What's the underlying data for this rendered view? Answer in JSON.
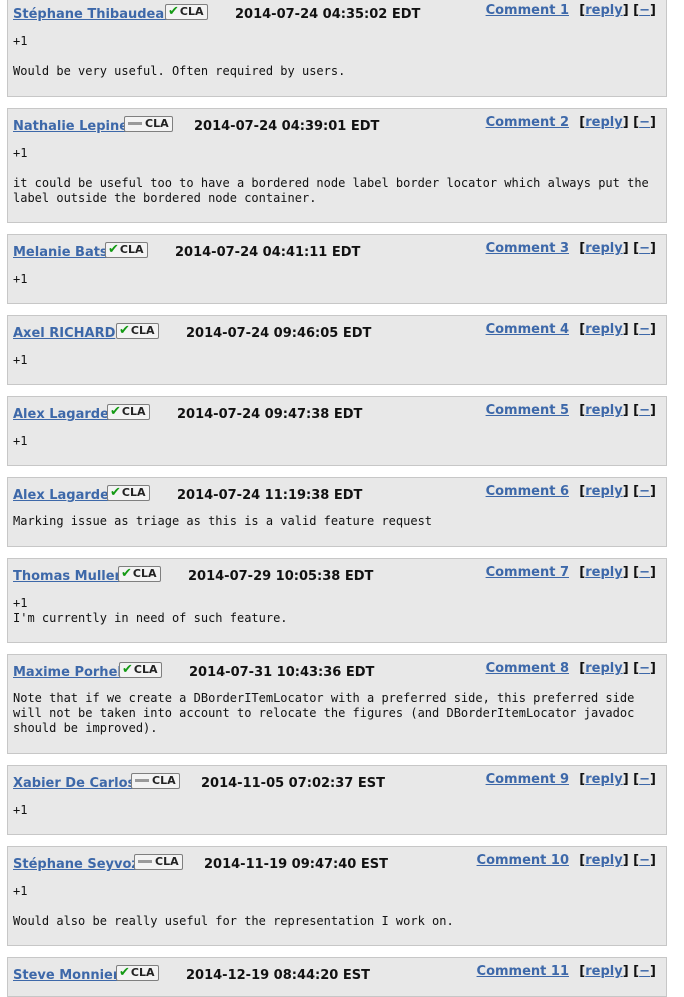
{
  "comments": [
    {
      "author": "Stéphane Thibaudeau",
      "cla": "CLA",
      "cla_signed": true,
      "date": "2014-07-24 04:35:02 EDT",
      "number": "Comment 1",
      "reply": "reply",
      "collapse": "−",
      "text": "+1\n\nWould be very useful. Often required by users."
    },
    {
      "author": "Nathalie Lepine",
      "cla": "CLA",
      "cla_signed": false,
      "date": "2014-07-24 04:39:01 EDT",
      "number": "Comment 2",
      "reply": "reply",
      "collapse": "−",
      "text": "+1\n\nit could be useful too to have a bordered node label border locator which always put the label outside the bordered node container."
    },
    {
      "author": "Melanie Bats",
      "cla": "CLA",
      "cla_signed": true,
      "date": "2014-07-24 04:41:11 EDT",
      "number": "Comment 3",
      "reply": "reply",
      "collapse": "−",
      "text": "+1"
    },
    {
      "author": "Axel RICHARD",
      "cla": "CLA",
      "cla_signed": true,
      "date": "2014-07-24 09:46:05 EDT",
      "number": "Comment 4",
      "reply": "reply",
      "collapse": "−",
      "text": "+1"
    },
    {
      "author": "Alex Lagarde",
      "cla": "CLA",
      "cla_signed": true,
      "date": "2014-07-24 09:47:38 EDT",
      "number": "Comment 5",
      "reply": "reply",
      "collapse": "−",
      "text": "+1"
    },
    {
      "author": "Alex Lagarde",
      "cla": "CLA",
      "cla_signed": true,
      "date": "2014-07-24 11:19:38 EDT",
      "number": "Comment 6",
      "reply": "reply",
      "collapse": "−",
      "text": "Marking issue as triage as this is a valid feature request"
    },
    {
      "author": "Thomas Muller",
      "cla": "CLA",
      "cla_signed": true,
      "date": "2014-07-29 10:05:38 EDT",
      "number": "Comment 7",
      "reply": "reply",
      "collapse": "−",
      "text": "+1\nI'm currently in need of such feature."
    },
    {
      "author": "Maxime Porhel",
      "cla": "CLA",
      "cla_signed": true,
      "date": "2014-07-31 10:43:36 EDT",
      "number": "Comment 8",
      "reply": "reply",
      "collapse": "−",
      "text": "Note that if we create a DBorderITemLocator with a preferred side, this preferred side will not be taken into account to relocate the figures (and DBorderItemLocator javadoc should be improved)."
    },
    {
      "author": "Xabier De Carlos",
      "cla": "CLA",
      "cla_signed": false,
      "date": "2014-11-05 07:02:37 EST",
      "number": "Comment 9",
      "reply": "reply",
      "collapse": "−",
      "text": "+1"
    },
    {
      "author": "Stéphane Seyvoz",
      "cla": "CLA",
      "cla_signed": false,
      "date": "2014-11-19 09:47:40 EST",
      "number": "Comment 10",
      "reply": "reply",
      "collapse": "−",
      "text": "+1\n\nWould also be really useful for the representation I work on."
    },
    {
      "author": "Steve Monnier",
      "cla": "CLA",
      "cla_signed": true,
      "date": "2014-12-19 08:44:20 EST",
      "number": "Comment 11",
      "reply": "reply",
      "collapse": "−",
      "text": ""
    }
  ],
  "colors": {
    "link": "#3d68a9",
    "check": "#139a13",
    "panel": "#e8e8e8"
  }
}
